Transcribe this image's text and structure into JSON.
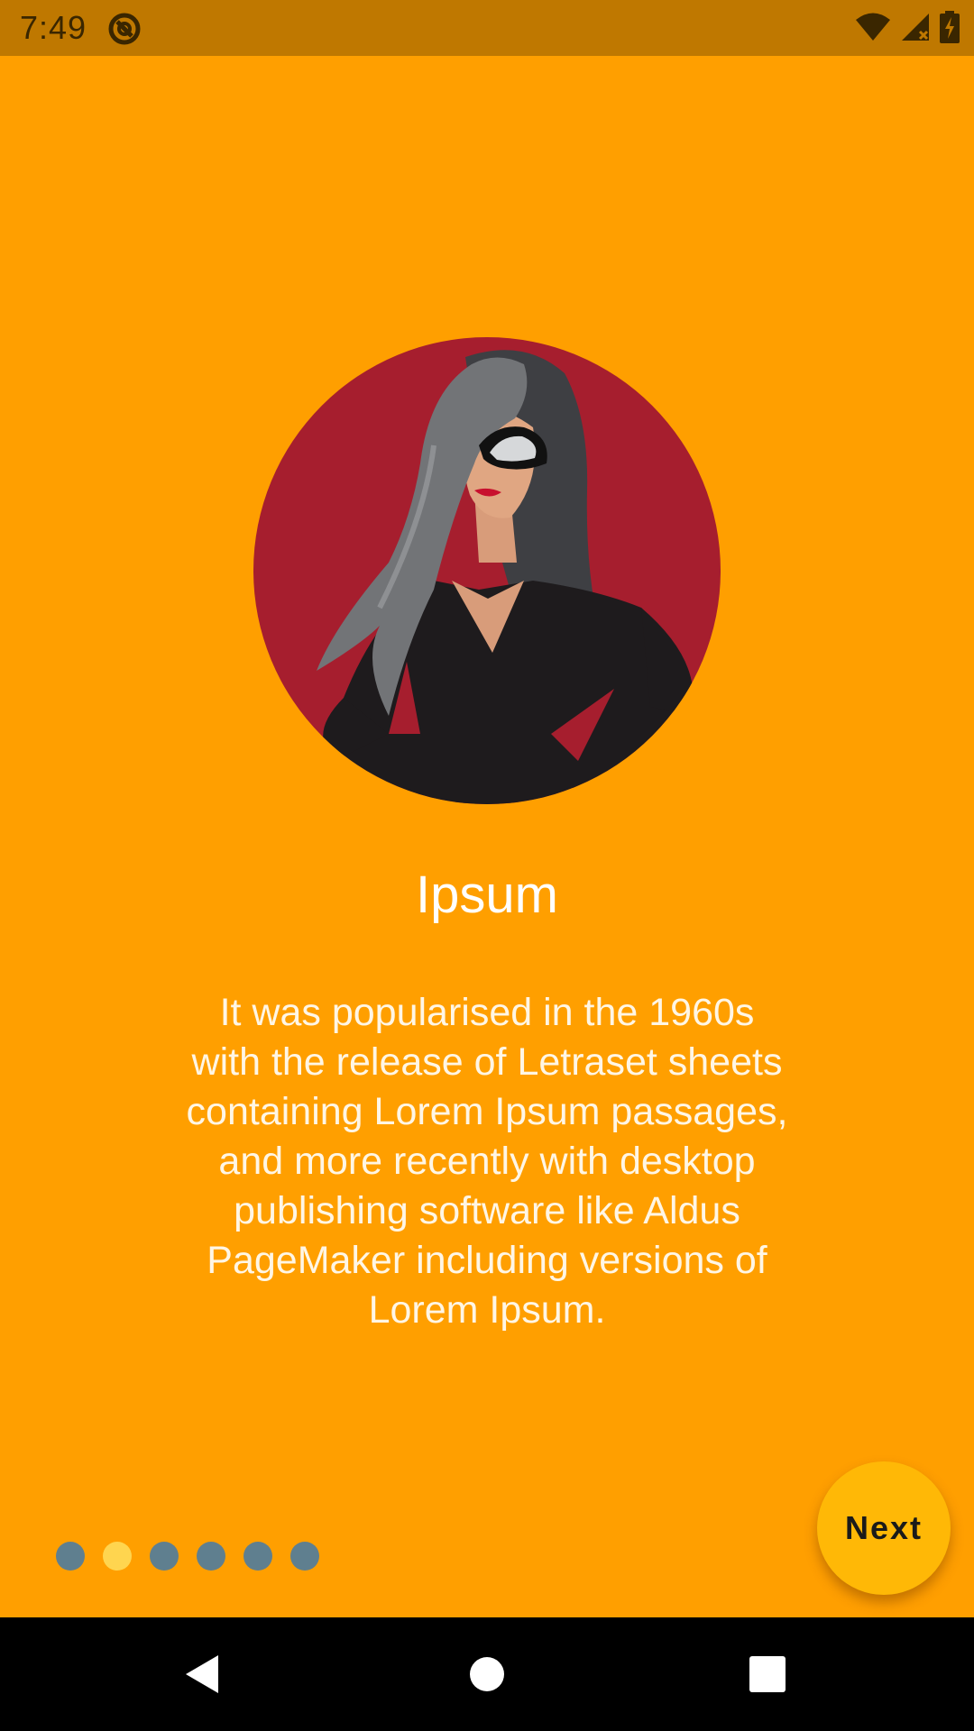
{
  "status_bar": {
    "time": "7:49",
    "icons": [
      "sync-app-icon",
      "wifi-icon",
      "cell-signal-icon",
      "battery-charging-icon"
    ]
  },
  "slide": {
    "image": "woman-with-glasses-illustration",
    "title": "Ipsum",
    "body": "It was popularised in the 1960s\nwith the release of Letraset sheets\ncontaining Lorem Ipsum passages,\nand more recently with desktop\npublishing software like Aldus\nPageMaker including versions of\nLorem Ipsum."
  },
  "pager": {
    "total": 6,
    "active_index": 1
  },
  "next_button": {
    "label": "Next"
  },
  "nav_bar": {
    "icons": [
      "back-icon",
      "home-icon",
      "recents-icon"
    ]
  },
  "colors": {
    "background": "#FF9F00",
    "status_bar": "#BF7800",
    "avatar_bg": "#A61E2E",
    "dot_inactive": "#5F7F8F",
    "dot_active": "#FFD54F",
    "fab": "#FFB806"
  }
}
